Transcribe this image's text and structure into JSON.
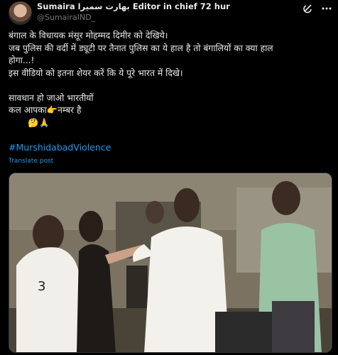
{
  "post": {
    "author": {
      "display_name": "Sumaira بھارت سمیرا Editor in chief 72 hur",
      "handle": "@SumairaIND_"
    },
    "text_lines": [
      "बंगाल के विधायक मंसूर मोहम्मद दिमीर को देखिये।",
      "जब पुलिस की वर्दी में ड्यूटी पर तैनात पुलिस का ये हाल है तो बंगालियों का क्या हाल",
      "होगा...!",
      "इस वीडियो को इतना शेयर करें कि ये पूरे भारत में दिखे।",
      "",
      "सावधान हो जाओ भारतीयों",
      "कल आपका👉नम्बर है",
      "       🤔🙏"
    ],
    "hashtag": "#MurshidabadViolence",
    "translate_label": "Translate post",
    "icons": [
      "avatar",
      "grok-icon",
      "more-icon"
    ],
    "media": {
      "description_icon": "video-thumbnail"
    }
  }
}
